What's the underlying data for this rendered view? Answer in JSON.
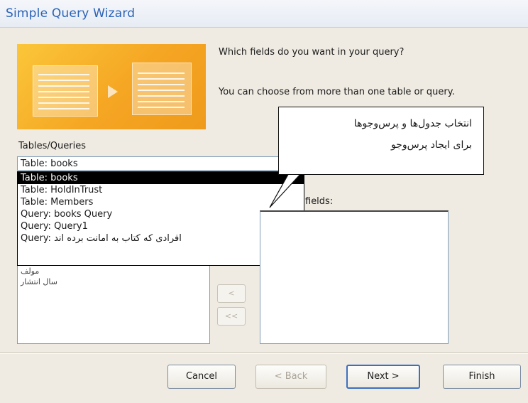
{
  "window": {
    "title": "Simple Query Wizard"
  },
  "prompt": {
    "question": "Which fields do you want in your query?",
    "hint": "You can choose from more than one table or query."
  },
  "tables_queries": {
    "label": "Tables/Queries",
    "selected_value": "Table: books",
    "options": [
      "Table: books",
      "Table: HoldInTrust",
      "Table: Members",
      "Query: books Query",
      "Query: Query1",
      "Query: افرادی که کتاب به امانت برده اند"
    ]
  },
  "available_fields": {
    "items": [
      "مولف",
      "سال انتشار"
    ]
  },
  "selected_fields": {
    "label": "fields:"
  },
  "move_buttons": {
    "remove_one": "<",
    "remove_all": "<<"
  },
  "buttons": {
    "cancel": "Cancel",
    "back": "< Back",
    "next": "Next >",
    "finish": "Finish"
  },
  "callout": {
    "line1": "انتخاب جدول‌ها و پرس‌وجوها",
    "line2": "برای ایجاد پرس‌وجو"
  },
  "colors": {
    "title": "#2a62b8",
    "banner": "#f5a623",
    "selection": "#000000",
    "default_button_border": "#3c6fbf"
  }
}
